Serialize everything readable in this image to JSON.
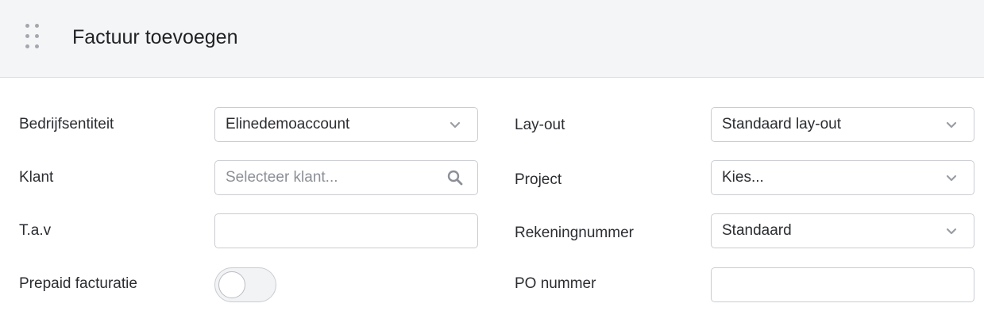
{
  "header": {
    "title": "Factuur toevoegen"
  },
  "form": {
    "left": {
      "company": {
        "label": "Bedrijfsentiteit",
        "value": "Elinedemoaccount"
      },
      "client": {
        "label": "Klant",
        "placeholder": "Selecteer klant..."
      },
      "attention": {
        "label": "T.a.v",
        "value": ""
      },
      "prepaid": {
        "label": "Prepaid facturatie",
        "enabled": false
      }
    },
    "right": {
      "layout": {
        "label": "Lay-out",
        "value": "Standaard lay-out"
      },
      "project": {
        "label": "Project",
        "value": "Kies..."
      },
      "account": {
        "label": "Rekeningnummer",
        "value": "Standaard"
      },
      "po": {
        "label": "PO nummer",
        "value": ""
      }
    }
  },
  "icons": {
    "drag": "drag-handle-icon",
    "chevron": "chevron-down-icon",
    "search": "search-icon"
  },
  "colors": {
    "header_bg": "#f4f5f6",
    "border": "#c9ccd1",
    "icon": "#a4a8ae"
  }
}
